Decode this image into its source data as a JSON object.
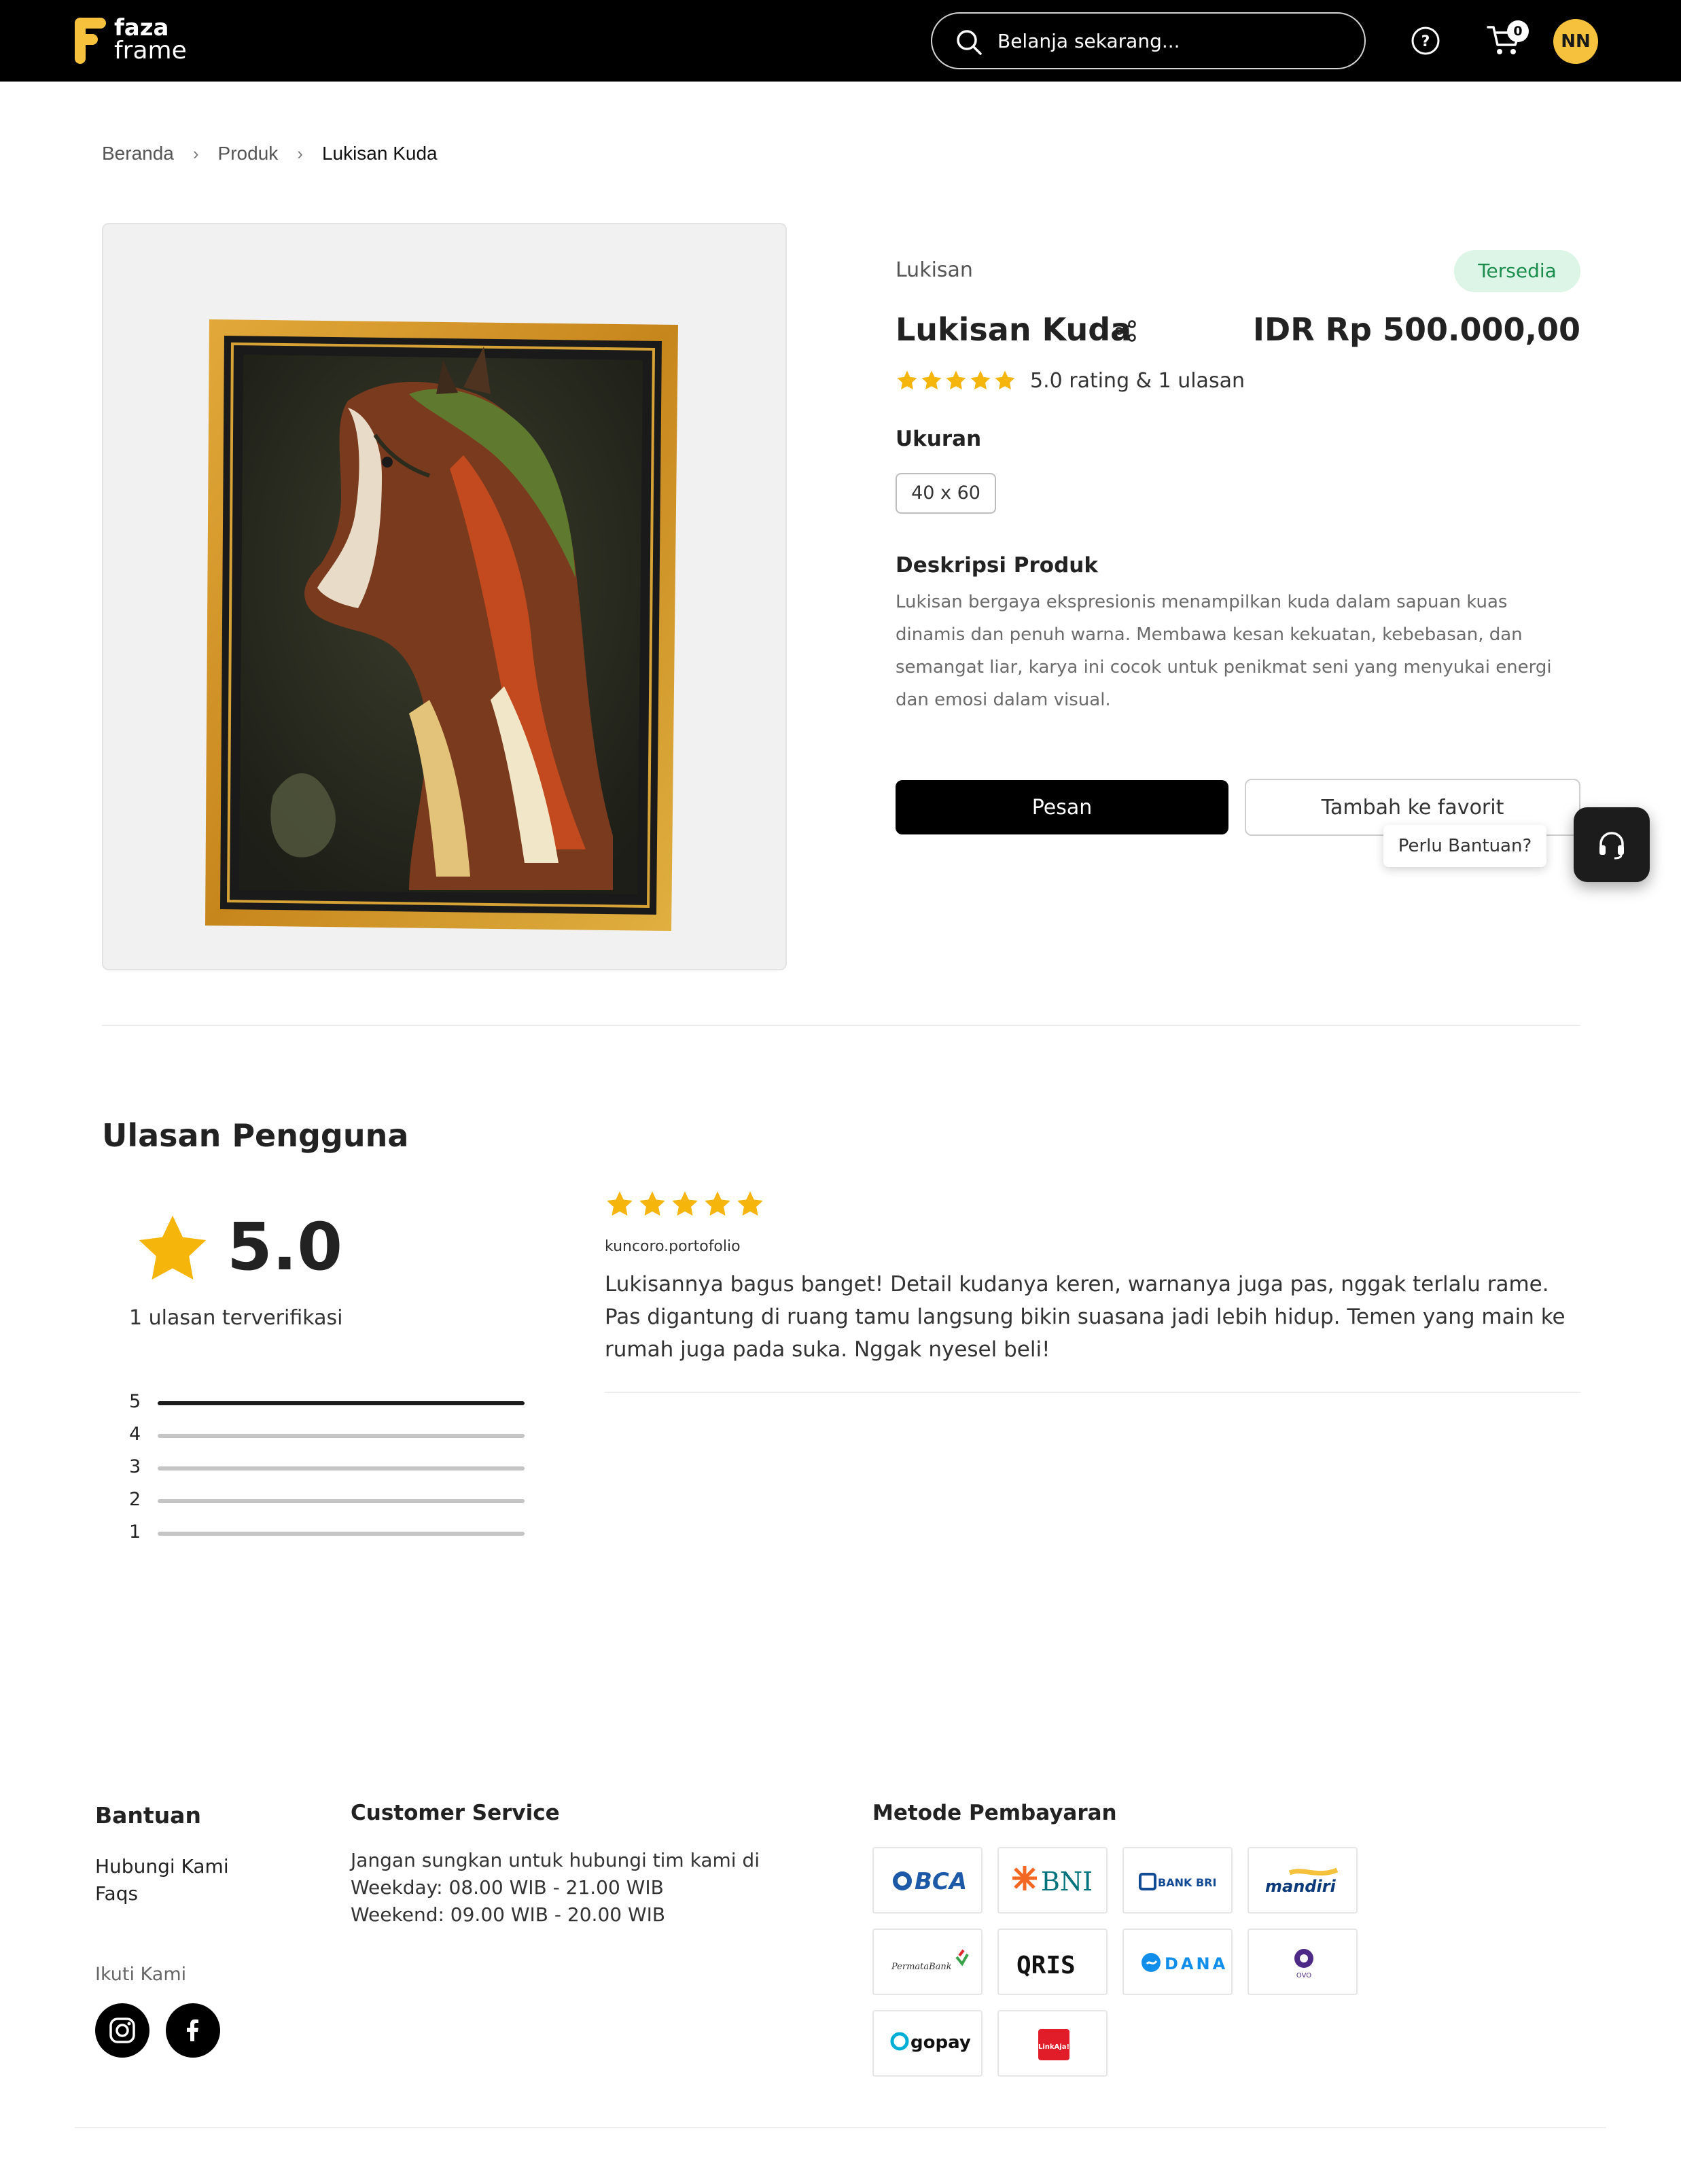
{
  "header": {
    "logo_line1": "faza",
    "logo_line2": "frame",
    "search_placeholder": "Belanja sekarang...",
    "cart_count": "0",
    "avatar_initials": "NN"
  },
  "breadcrumb": [
    "Beranda",
    "Produk",
    "Lukisan Kuda"
  ],
  "product": {
    "category": "Lukisan",
    "stock_status": "Tersedia",
    "title": "Lukisan Kuda",
    "price": "IDR Rp 500.000,00",
    "rating_summary": "5.0 rating & 1 ulasan",
    "size_label": "Ukuran",
    "size_option": "40 x 60",
    "description_label": "Deskripsi Produk",
    "description": "Lukisan bergaya ekspresionis menampilkan kuda dalam sapuan kuas dinamis dan penuh warna. Membawa kesan kekuatan, kebebasan, dan semangat liar, karya ini cocok untuk penikmat seni yang menyukai energi dan emosi dalam visual.",
    "order_button": "Pesan",
    "favorite_button": "Tambah ke favorit"
  },
  "help": {
    "tooltip": "Perlu Bantuan?"
  },
  "reviews": {
    "title": "Ulasan Pengguna",
    "average": "5.0",
    "verified_count": "1 ulasan terverifikasi",
    "distribution": [
      {
        "stars": "5",
        "fraction": 1.0
      },
      {
        "stars": "4",
        "fraction": 0
      },
      {
        "stars": "3",
        "fraction": 0
      },
      {
        "stars": "2",
        "fraction": 0
      },
      {
        "stars": "1",
        "fraction": 0
      }
    ],
    "items": [
      {
        "rating": 5,
        "user": "kuncoro.portofolio",
        "text": "Lukisannya bagus banget! Detail kudanya keren, warnanya juga pas, nggak terlalu rame. Pas digantung di ruang tamu langsung bikin suasana jadi lebih hidup. Temen yang main ke rumah juga pada suka. Nggak nyesel beli!"
      }
    ]
  },
  "footer": {
    "help_title": "Bantuan",
    "help_links": [
      "Hubungi Kami",
      "Faqs"
    ],
    "follow_label": "Ikuti Kami",
    "cs_title": "Customer Service",
    "cs_lines": [
      "Jangan sungkan untuk hubungi tim kami di",
      "Weekday: 08.00 WIB - 21.00 WIB",
      "Weekend: 09.00 WIB - 20.00 WIB"
    ],
    "payment_title": "Metode Pembayaran",
    "payment_methods": [
      "BCA",
      "BNI",
      "BANK BRI",
      "mandiri",
      "PermataBank",
      "QRIS",
      "DANA",
      "OVO",
      "gopay",
      "LinkAja!"
    ]
  },
  "colors": {
    "accent_yellow": "#f6c23e",
    "star": "#f5b50a",
    "stock_bg": "#dcf5e6",
    "stock_text": "#1b8d4e"
  },
  "icons": [
    "logo-icon",
    "search-icon",
    "help-circle-icon",
    "cart-icon",
    "share-icon",
    "star-icon",
    "headset-icon",
    "instagram-icon",
    "facebook-icon"
  ]
}
